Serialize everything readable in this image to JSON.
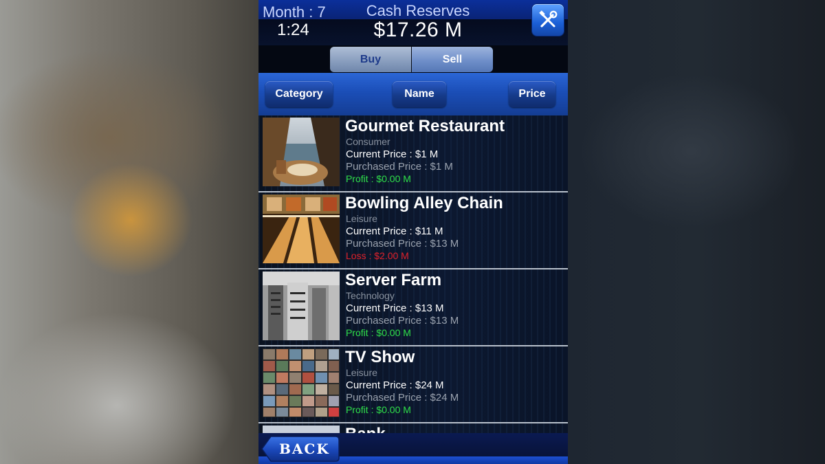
{
  "header": {
    "month": "Month : 7",
    "clock": "1:24",
    "cash_label": "Cash Reserves",
    "cash_value": "$17.26 M",
    "tools_icon": "tools-icon"
  },
  "tabs": {
    "buy_label": "Buy",
    "sell_label": "Sell",
    "active": "Buy"
  },
  "sort": {
    "category_label": "Category",
    "name_label": "Name",
    "price_label": "Price"
  },
  "items": [
    {
      "name": "Gourmet Restaurant",
      "category": "Consumer",
      "current_price": "Current Price : $1 M",
      "purchased_price": "Purchased Price : $1 M",
      "result": "Profit : $0.00 M",
      "result_type": "profit"
    },
    {
      "name": "Bowling Alley Chain",
      "category": "Leisure",
      "current_price": "Current Price : $11 M",
      "purchased_price": "Purchased Price : $13 M",
      "result": "Loss : $2.00 M",
      "result_type": "loss"
    },
    {
      "name": "Server Farm",
      "category": "Technology",
      "current_price": "Current Price : $13 M",
      "purchased_price": "Purchased Price : $13 M",
      "result": "Profit : $0.00 M",
      "result_type": "profit"
    },
    {
      "name": "TV Show",
      "category": "Leisure",
      "current_price": "Current Price : $24 M",
      "purchased_price": "Purchased Price : $24 M",
      "result": "Profit : $0.00 M",
      "result_type": "profit"
    },
    {
      "name": "Bank",
      "partial": true
    }
  ],
  "footer": {
    "back_label": "BACK"
  },
  "colors": {
    "profit": "#2fe04a",
    "loss": "#e0202a",
    "accent_blue": "#1b4eb7"
  }
}
